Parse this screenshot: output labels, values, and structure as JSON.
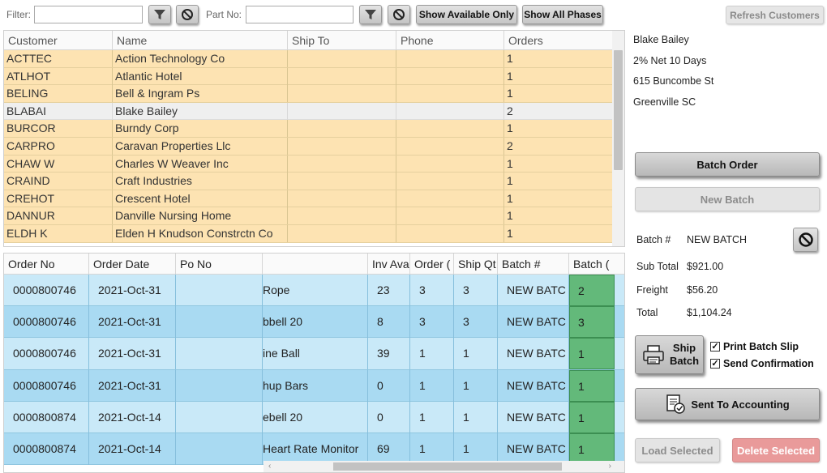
{
  "toolbar": {
    "filter_label": "Filter:",
    "filter_value": "",
    "part_label": "Part No:",
    "part_value": "",
    "show_available_label": "Show Available Only",
    "show_all_phases_label": "Show All Phases",
    "icons": [
      "filter-icon",
      "clear-icon"
    ]
  },
  "customers": {
    "columns": [
      "Customer",
      "Name",
      "Ship To",
      "Phone",
      "Orders"
    ],
    "rows": [
      {
        "code": "ACTTEC",
        "name": "Action Technology Co",
        "ship_to": "",
        "phone": "",
        "orders": "1",
        "selected": false
      },
      {
        "code": "ATLHOT",
        "name": "Atlantic Hotel",
        "ship_to": "",
        "phone": "",
        "orders": "1",
        "selected": false
      },
      {
        "code": "BELING",
        "name": "Bell & Ingram Ps",
        "ship_to": "",
        "phone": "",
        "orders": "1",
        "selected": false
      },
      {
        "code": "BLABAI",
        "name": "Blake Bailey",
        "ship_to": "",
        "phone": "",
        "orders": "2",
        "selected": true
      },
      {
        "code": "BURCOR",
        "name": "Burndy Corp",
        "ship_to": "",
        "phone": "",
        "orders": "1",
        "selected": false
      },
      {
        "code": "CARPRO",
        "name": "Caravan Properties Llc",
        "ship_to": "",
        "phone": "",
        "orders": "2",
        "selected": false
      },
      {
        "code": "CHAW W",
        "name": "Charles W Weaver Inc",
        "ship_to": "",
        "phone": "",
        "orders": "1",
        "selected": false
      },
      {
        "code": "CRAIND",
        "name": "Craft Industries",
        "ship_to": "",
        "phone": "",
        "orders": "1",
        "selected": false
      },
      {
        "code": "CREHOT",
        "name": "Crescent Hotel",
        "ship_to": "",
        "phone": "",
        "orders": "1",
        "selected": false
      },
      {
        "code": "DANNUR",
        "name": "Danville Nursing Home",
        "ship_to": "",
        "phone": "",
        "orders": "1",
        "selected": false
      },
      {
        "code": "ELDH K",
        "name": "Elden H Knudson Constrctn Co",
        "ship_to": "",
        "phone": "",
        "orders": "1",
        "selected": false
      }
    ]
  },
  "orders": {
    "columns": [
      "Order No",
      "Order Date",
      "Po No",
      "",
      "Inv Ava",
      "Order (",
      "Ship Qt",
      "Batch #",
      "Batch ("
    ],
    "rows": [
      {
        "order_no": "0000800746",
        "order_date": "2021-Oct-31",
        "po_no": "",
        "item": "Rope",
        "inv": "23",
        "order_qty": "3",
        "ship_qty": "3",
        "batch": "NEW BATC",
        "batch_qty": "2"
      },
      {
        "order_no": "0000800746",
        "order_date": "2021-Oct-31",
        "po_no": "",
        "item": "bbell 20",
        "inv": "8",
        "order_qty": "3",
        "ship_qty": "3",
        "batch": "NEW BATC",
        "batch_qty": "3"
      },
      {
        "order_no": "0000800746",
        "order_date": "2021-Oct-31",
        "po_no": "",
        "item": "ine Ball",
        "inv": "39",
        "order_qty": "1",
        "ship_qty": "1",
        "batch": "NEW BATC",
        "batch_qty": "1"
      },
      {
        "order_no": "0000800746",
        "order_date": "2021-Oct-31",
        "po_no": "",
        "item": "hup Bars",
        "inv": "0",
        "order_qty": "1",
        "ship_qty": "1",
        "batch": "NEW BATC",
        "batch_qty": "1"
      },
      {
        "order_no": "0000800874",
        "order_date": "2021-Oct-14",
        "po_no": "",
        "item": "ebell 20",
        "inv": "0",
        "order_qty": "1",
        "ship_qty": "1",
        "batch": "NEW BATC",
        "batch_qty": "1"
      },
      {
        "order_no": "0000800874",
        "order_date": "2021-Oct-14",
        "po_no": "",
        "item": "Heart Rate Monitor",
        "inv": "69",
        "order_qty": "1",
        "ship_qty": "1",
        "batch": "NEW BATC",
        "batch_qty": "1"
      }
    ]
  },
  "customer_info": {
    "name": "Blake Bailey",
    "terms": "2% Net 10 Days",
    "address": "615 Buncombe St",
    "city_state": "Greenville  SC"
  },
  "actions": {
    "refresh_customers": "Refresh Customers",
    "batch_order": "Batch Order",
    "new_batch": "New Batch",
    "ship_batch": "Ship Batch",
    "sent_to_accounting": "Sent To Accounting",
    "load_selected": "Load Selected",
    "delete_selected": "Delete Selected"
  },
  "batch": {
    "batch_label": "Batch #",
    "batch_value": "NEW BATCH",
    "subtotal_label": "Sub Total",
    "subtotal_value": "$921.00",
    "freight_label": "Freight",
    "freight_value": "$56.20",
    "total_label": "Total",
    "total_value": "$1,104.24"
  },
  "options": {
    "print_batch_slip": {
      "label": "Print Batch Slip",
      "checked": true
    },
    "send_confirmation": {
      "label": "Send Confirmation",
      "checked": true
    }
  },
  "colors": {
    "customer_row": "#fde3b2",
    "selected_row": "#efefef",
    "order_row_light": "#c9e9f8",
    "order_row_dark": "#a9daf2",
    "batch_qty_cell": "#63b97a",
    "delete_button": "#e99a9a"
  }
}
